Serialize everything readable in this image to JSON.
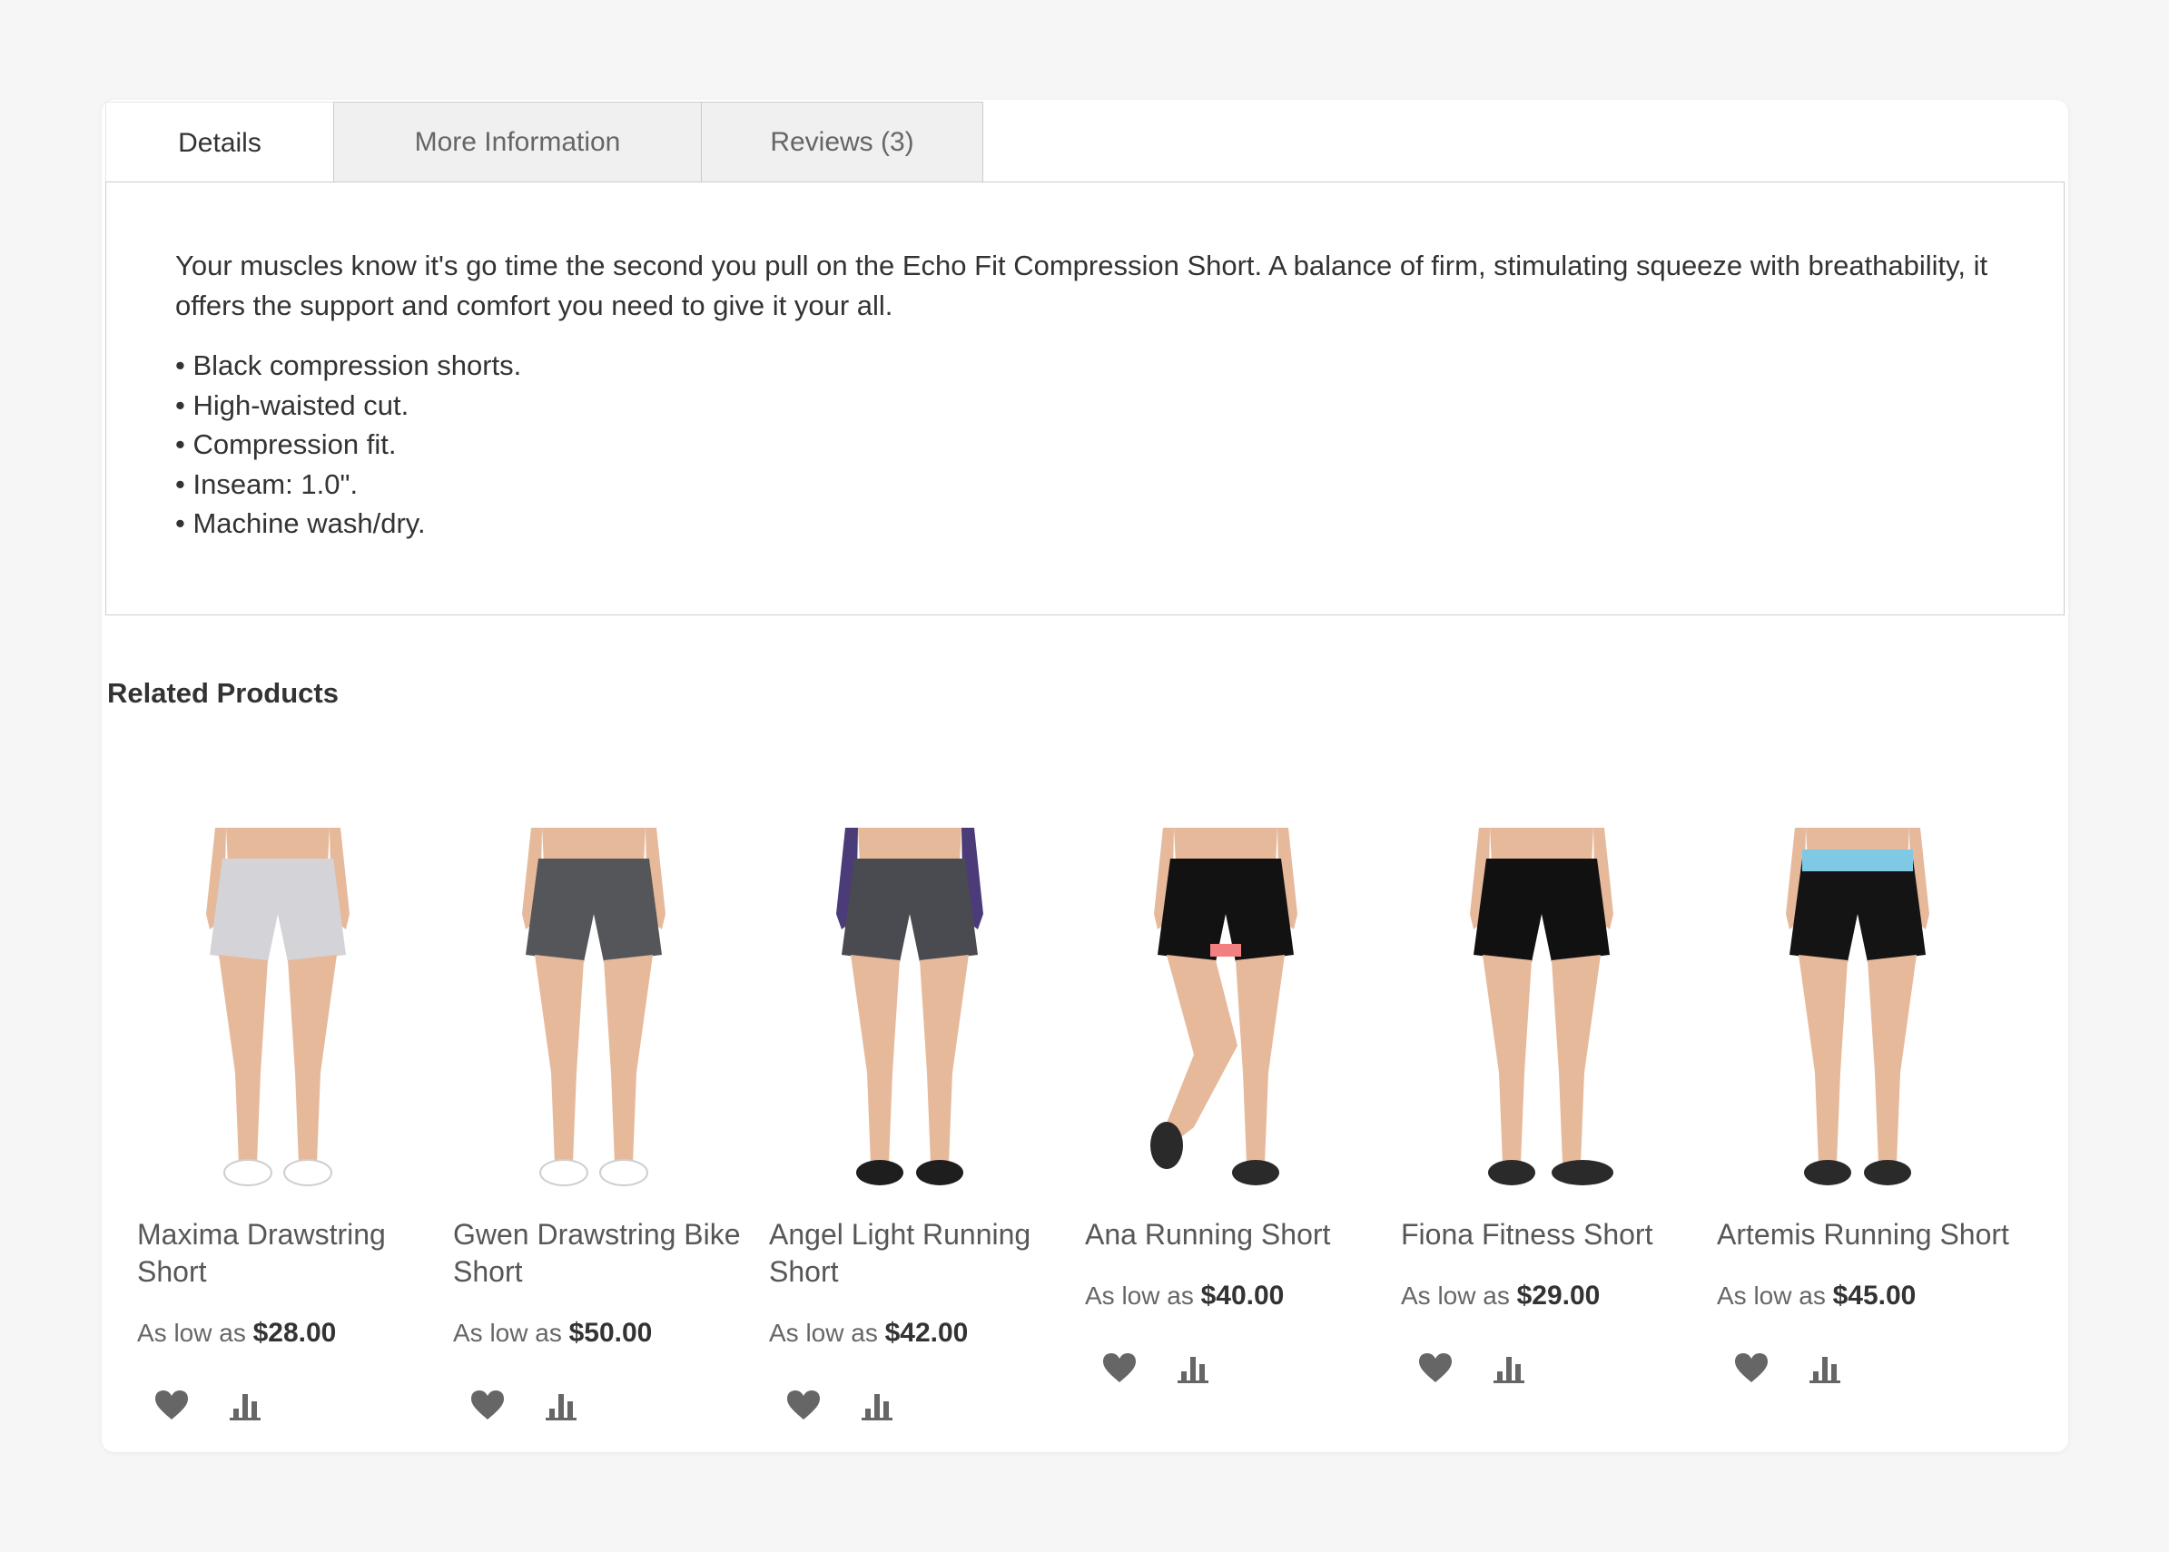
{
  "tabs": [
    {
      "label": "Details",
      "active": true
    },
    {
      "label": "More Information",
      "active": false
    },
    {
      "label": "Reviews (3)",
      "active": false
    }
  ],
  "details": {
    "description": "Your muscles know it's go time the second you pull on the Echo Fit Compression Short. A balance of firm, stimulating squeeze with breathability, it offers the support and comfort you need to give it your all.",
    "bullets": [
      "Black compression shorts.",
      "High-waisted cut.",
      "Compression fit.",
      "Inseam: 1.0\".",
      "Machine wash/dry."
    ]
  },
  "related": {
    "title": "Related Products",
    "price_prefix": "As low as",
    "products": [
      {
        "name": "Maxima Drawstring Short",
        "price": "$28.00",
        "shorts_color": "#d4d4d8",
        "shoe_color": "#ffffff",
        "sleeve_color": ""
      },
      {
        "name": "Gwen Drawstring Bike Short",
        "price": "$50.00",
        "shorts_color": "#55565a",
        "shoe_color": "#ffffff",
        "sleeve_color": ""
      },
      {
        "name": "Angel Light Running Short",
        "price": "$42.00",
        "shorts_color": "#4a4b50",
        "shoe_color": "#1e1e1e",
        "sleeve_color": "#4b3b78"
      },
      {
        "name": "Ana Running Short",
        "price": "$40.00",
        "shorts_color": "#121212",
        "shoe_color": "#2a2a2a",
        "sleeve_color": ""
      },
      {
        "name": "Fiona Fitness Short",
        "price": "$29.00",
        "shorts_color": "#111111",
        "shoe_color": "#2a2a2a",
        "sleeve_color": ""
      },
      {
        "name": "Artemis Running Short",
        "price": "$45.00",
        "shorts_color": "#141414",
        "shoe_color": "#2a2a2a",
        "sleeve_color": ""
      }
    ]
  },
  "colors": {
    "skin": "#e6b99b",
    "icon": "#666666",
    "waistband_artemis": "#7fc9e4",
    "liner_ana": "#f28080"
  },
  "icons": {
    "wishlist": "heart-icon",
    "compare": "bar-chart-icon"
  }
}
